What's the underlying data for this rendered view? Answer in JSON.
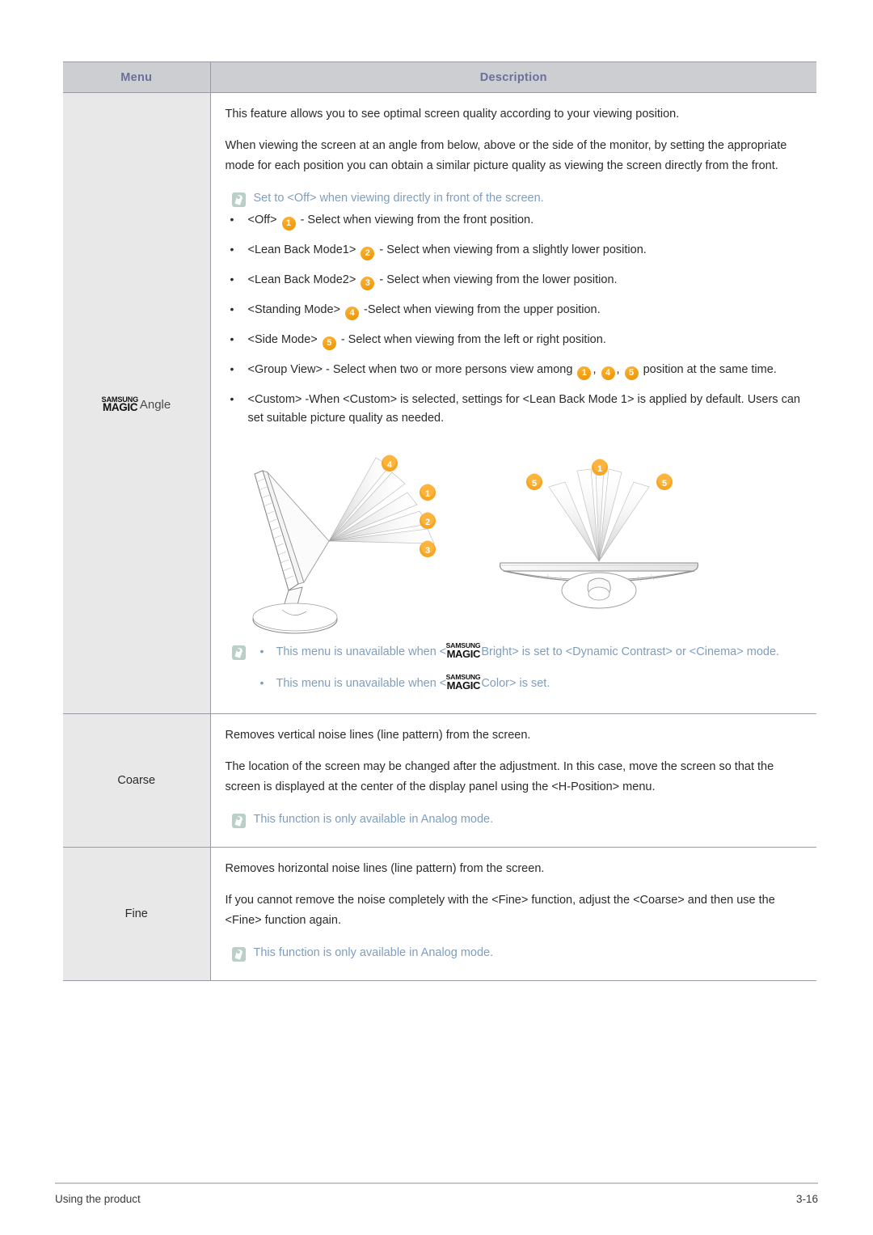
{
  "table": {
    "headers": {
      "menu": "Menu",
      "description": "Description"
    },
    "rows": [
      {
        "menu_logo": {
          "top": "SAMSUNG",
          "bottom": "MAGIC"
        },
        "menu_suffix": "Angle",
        "paragraphs": [
          "This feature allows you to see optimal screen quality according to your viewing position.",
          "When viewing the screen at an angle from below, above or the side of the monitor, by setting the appropriate mode for each position you can obtain a similar picture quality as viewing the screen directly from the front."
        ],
        "note_top": "Set to <Off> when viewing directly in front of the screen.",
        "modes": [
          {
            "label": "<Off>",
            "badges": [
              "1"
            ],
            "desc": "- Select when viewing from the front position."
          },
          {
            "label": "<Lean Back Mode1>",
            "badges": [
              "2"
            ],
            "desc": "- Select when viewing from a slightly lower position."
          },
          {
            "label": "<Lean Back Mode2>",
            "badges": [
              "3"
            ],
            "desc": "- Select when viewing from the lower position."
          },
          {
            "label": "<Standing Mode>",
            "badges": [
              "4"
            ],
            "desc": "-Select when viewing from the upper position."
          },
          {
            "label": "<Side Mode>",
            "badges": [
              "5"
            ],
            "desc": "- Select when viewing from the left or right position."
          }
        ],
        "group_view": {
          "label": "<Group View>",
          "pre": "- Select when two or more persons view among",
          "badges": [
            "1",
            "4",
            "5"
          ],
          "post": "position at the same time."
        },
        "custom": "<Custom> -When <Custom> is selected, settings for <Lean Back Mode 1> is applied by default. Users can set suitable picture quality as needed.",
        "illustration": {
          "left_badges": [
            "4",
            "1",
            "2",
            "3"
          ],
          "right_badges": [
            "5",
            "1",
            "5"
          ]
        },
        "notes_bottom": [
          {
            "pre": "This menu is unavailable when <",
            "logo": {
              "top": "SAMSUNG",
              "bottom": "MAGIC"
            },
            "post": "Bright> is set to <Dynamic Contrast> or <Cinema> mode."
          },
          {
            "pre": "This menu is unavailable when <",
            "logo": {
              "top": "SAMSUNG",
              "bottom": "MAGIC"
            },
            "post": "Color> is set."
          }
        ]
      },
      {
        "menu": "Coarse",
        "paragraphs": [
          "Removes vertical noise lines (line pattern) from the screen.",
          "The location of the screen may be changed after the adjustment. In this case, move the screen so that the screen is displayed at the center of the display panel using the <H-Position> menu."
        ],
        "note": "This function is only available in Analog mode."
      },
      {
        "menu": "Fine",
        "paragraphs": [
          "Removes horizontal noise lines (line pattern) from the screen.",
          "If you cannot remove the noise completely with the <Fine> function, adjust the <Coarse> and then use the <Fine> function again."
        ],
        "note": "This function is only available in Analog mode."
      }
    ]
  },
  "footer": {
    "left": "Using the product",
    "right": "3-16"
  },
  "colors": {
    "header_bg": "#cdced2",
    "header_text": "#6b6f9c",
    "menu_cell_bg": "#e8e8e8",
    "note_text": "#7f9ebd",
    "badge_orange": "#f6a623",
    "note_icon": "#b9cfc8",
    "border": "#9a9aa4"
  }
}
